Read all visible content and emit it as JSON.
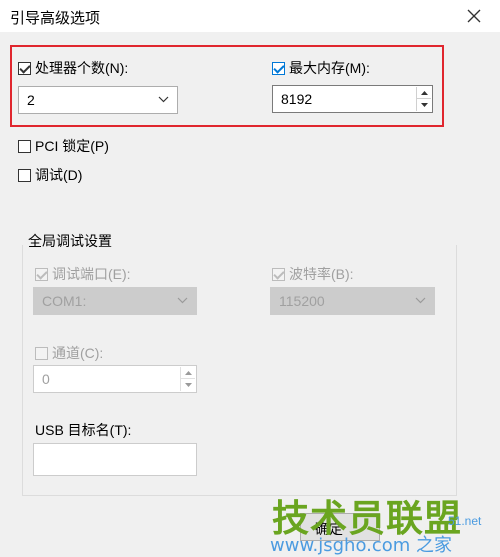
{
  "window": {
    "title": "引导高级选项",
    "close_label": "×"
  },
  "processors": {
    "label": "处理器个数(N):",
    "checked": true,
    "value": "2"
  },
  "memory": {
    "label": "最大内存(M):",
    "checked": true,
    "value": "8192"
  },
  "pci_lock": {
    "label": "PCI 锁定(P)",
    "checked": false
  },
  "debug": {
    "label": "调试(D)",
    "checked": false
  },
  "global_debug": {
    "title": "全局调试设置",
    "debug_port": {
      "label": "调试端口(E):",
      "checked": true,
      "value": "COM1:"
    },
    "baud_rate": {
      "label": "波特率(B):",
      "checked": true,
      "value": "115200"
    },
    "channel": {
      "label": "通道(C):",
      "checked": false,
      "value": "0"
    },
    "usb_target": {
      "label": "USB 目标名(T):",
      "value": ""
    }
  },
  "buttons": {
    "ok_label": "确定"
  },
  "watermark": {
    "brand": "技术员联盟",
    "url": "www.jsgho.com",
    "side": "51.net",
    "suffix": "之家"
  },
  "colors": {
    "highlight": "#e0262e",
    "accent": "#0078d7",
    "dialog_bg": "#f0f0f0"
  }
}
